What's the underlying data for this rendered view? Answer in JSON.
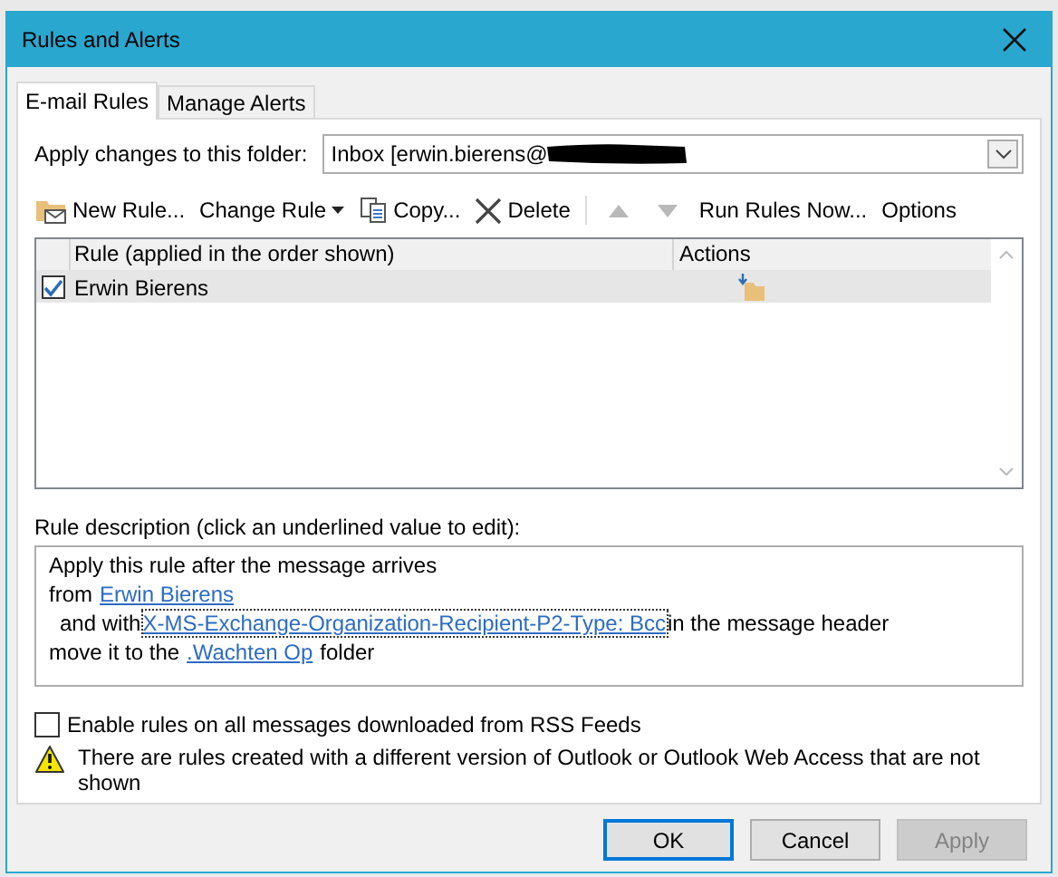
{
  "window": {
    "title": "Rules and Alerts"
  },
  "tabs": [
    {
      "label": "E-mail Rules",
      "selected": true
    },
    {
      "label": "Manage Alerts",
      "selected": false
    }
  ],
  "folder": {
    "label": "Apply changes to this folder:",
    "value": "Inbox [erwin.bierens@"
  },
  "toolbar": [
    {
      "kind": "new",
      "label": "New Rule...",
      "disabled": false
    },
    {
      "kind": "change",
      "label": "Change Rule",
      "disabled": false
    },
    {
      "kind": "copy",
      "label": "Copy...",
      "disabled": false
    },
    {
      "kind": "delete",
      "label": "Delete",
      "disabled": false
    },
    {
      "kind": "up",
      "disabled": true
    },
    {
      "kind": "down",
      "disabled": true
    },
    {
      "kind": "run",
      "label": "Run Rules Now...",
      "disabled": false
    },
    {
      "kind": "options",
      "label": "Options",
      "disabled": false
    }
  ],
  "rules_table": {
    "columns": [
      "Rule (applied in the order shown)",
      "Actions"
    ],
    "rows": [
      {
        "checked": true,
        "name": "Erwin Bierens",
        "selected": true
      }
    ]
  },
  "description": {
    "label": "Rule description (click an underlined value to edit):",
    "lines": [
      {
        "indent": false,
        "parts": [
          {
            "text": "Apply this rule after the message arrives",
            "link": false,
            "focused": false
          }
        ]
      },
      {
        "indent": false,
        "parts": [
          {
            "text": "from",
            "link": false,
            "focused": false
          },
          {
            "text": "Erwin Bierens",
            "link": true,
            "focused": false
          }
        ]
      },
      {
        "indent": true,
        "parts": [
          {
            "text": "and with",
            "link": false,
            "focused": false
          },
          {
            "text": "X-MS-Exchange-Organization-Recipient-P2-Type: Bcc",
            "link": true,
            "focused": true
          },
          {
            "text": "in the message header",
            "link": false,
            "focused": false
          }
        ]
      },
      {
        "indent": false,
        "parts": [
          {
            "text": "move it to the",
            "link": false,
            "focused": false
          },
          {
            "text": ".Wachten Op",
            "link": true,
            "focused": false
          },
          {
            "text": "folder",
            "link": false,
            "focused": false
          }
        ]
      }
    ]
  },
  "rss_option": {
    "label": "Enable rules on all messages downloaded from RSS Feeds",
    "checked": false
  },
  "warning": "There are rules created with a different version of Outlook or Outlook Web Access that are not shown",
  "buttons": [
    {
      "label": "OK",
      "default": true,
      "disabled": false
    },
    {
      "label": "Cancel",
      "default": false,
      "disabled": false
    },
    {
      "label": "Apply",
      "default": false,
      "disabled": true
    }
  ]
}
